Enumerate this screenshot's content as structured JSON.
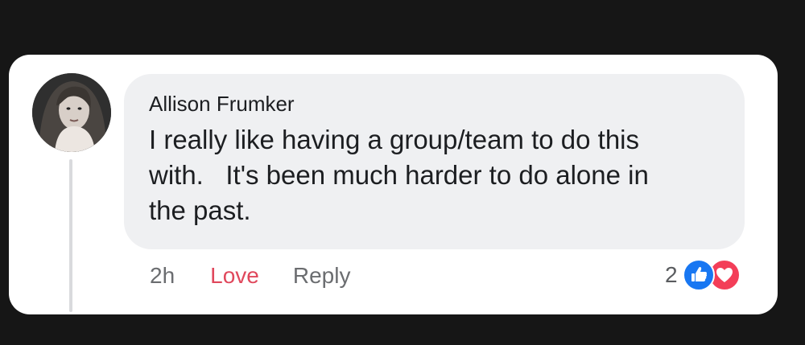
{
  "comment": {
    "author": "Allison Frumker",
    "text": "I really like having a group/team to do this\nwith.   It's been much harder to do alone in\nthe past.",
    "avatar_icon": "profile-photo"
  },
  "actions": {
    "time": "2h",
    "love_label": "Love",
    "reply_label": "Reply"
  },
  "reactions": {
    "count": "2",
    "icons": [
      "like-icon",
      "heart-icon"
    ]
  },
  "colors": {
    "love": "#e0485c",
    "like": "#1877f2",
    "heart": "#f33e58",
    "bubble": "#eff0f2"
  }
}
